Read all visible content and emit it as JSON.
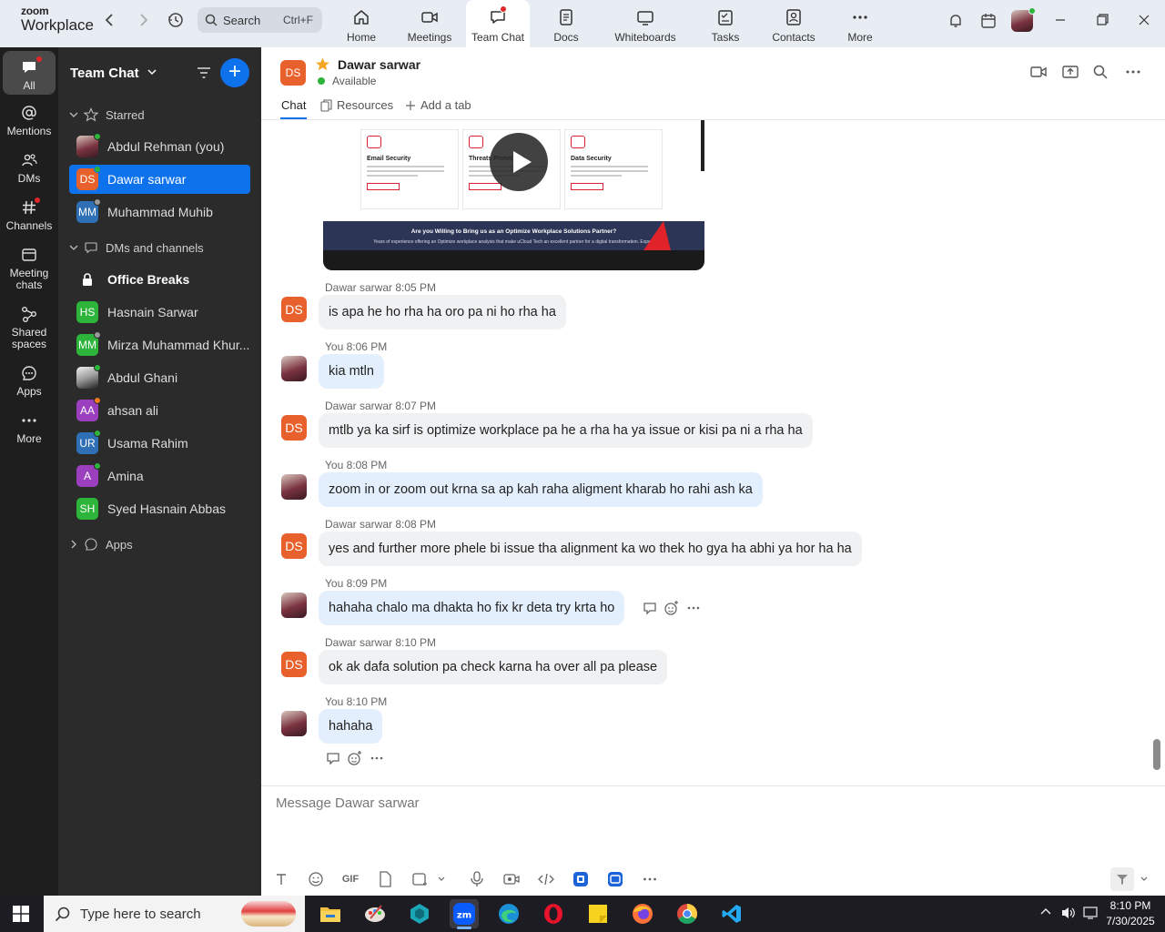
{
  "app": {
    "brand_top": "zoom",
    "brand_bottom": "Workplace"
  },
  "search": {
    "label": "Search",
    "shortcut": "Ctrl+F"
  },
  "top_tabs": [
    {
      "label": "Home"
    },
    {
      "label": "Meetings"
    },
    {
      "label": "Team Chat"
    },
    {
      "label": "Docs"
    },
    {
      "label": "Whiteboards"
    },
    {
      "label": "Tasks"
    },
    {
      "label": "Contacts"
    },
    {
      "label": "More"
    }
  ],
  "rail": [
    {
      "label": "All"
    },
    {
      "label": "Mentions"
    },
    {
      "label": "DMs"
    },
    {
      "label": "Channels"
    },
    {
      "label": "Meeting chats"
    },
    {
      "label": "Shared spaces"
    },
    {
      "label": "Apps"
    },
    {
      "label": "More"
    }
  ],
  "sidebar": {
    "title": "Team Chat",
    "starred_label": "Starred",
    "dms_label": "DMs and channels",
    "apps_label": "Apps",
    "starred": [
      {
        "name": "Abdul Rehman (you)",
        "initials": "",
        "color": ""
      },
      {
        "name": "Dawar sarwar",
        "initials": "DS",
        "color": "#e8612c"
      },
      {
        "name": "Muhammad Muhib",
        "initials": "MM",
        "color": "#2f6fb5"
      }
    ],
    "dms": [
      {
        "name": "Office Breaks",
        "initials": "",
        "color": ""
      },
      {
        "name": "Hasnain Sarwar",
        "initials": "HS",
        "color": "#2db43a"
      },
      {
        "name": "Mirza Muhammad Khur...",
        "initials": "MM",
        "color": "#2db43a"
      },
      {
        "name": "Abdul Ghani",
        "initials": "",
        "color": ""
      },
      {
        "name": "ahsan ali",
        "initials": "AA",
        "color": "#9b3fbf"
      },
      {
        "name": "Usama Rahim",
        "initials": "UR",
        "color": "#2f6fb5"
      },
      {
        "name": "Amina",
        "initials": "A",
        "color": "#9b3fbf"
      },
      {
        "name": "Syed Hasnain Abbas",
        "initials": "SH",
        "color": "#2db43a"
      }
    ]
  },
  "chat": {
    "contact_initials": "DS",
    "contact_name": "Dawar sarwar",
    "status": "Available",
    "tabs": [
      {
        "label": "Chat"
      },
      {
        "label": "Resources"
      },
      {
        "label": "Add a tab"
      }
    ],
    "preview": {
      "cards": [
        {
          "title": "Email Security"
        },
        {
          "title": "Threats Protection"
        },
        {
          "title": "Data Security"
        }
      ],
      "banner_title": "Are you Willing to Bring us as an Optimize Workplace Solutions Partner?",
      "banner_sub": "Years of experience offering an Optimize workplace analysis that make uCloud Tech an excellent partner for a digital transformation. Expect"
    },
    "messages": [
      {
        "sender": "Dawar sarwar",
        "time": "8:05 PM",
        "text": "is apa he ho rha ha oro pa ni ho rha ha",
        "mine": false
      },
      {
        "sender": "You",
        "time": "8:06 PM",
        "text": "kia mtln",
        "mine": true
      },
      {
        "sender": "Dawar sarwar",
        "time": "8:07 PM",
        "text": "mtlb ya ka sirf is optimize workplace pa he a rha ha ya issue or kisi pa ni a rha ha",
        "mine": false
      },
      {
        "sender": "You",
        "time": "8:08 PM",
        "text": "zoom in or zoom out krna sa ap kah raha aligment kharab ho rahi ash ka",
        "mine": true
      },
      {
        "sender": "Dawar sarwar",
        "time": "8:08 PM",
        "text": "yes and further more phele bi issue tha alignment ka wo thek ho gya ha abhi ya hor ha ha",
        "mine": false
      },
      {
        "sender": "You",
        "time": "8:09 PM",
        "text": "hahaha chalo ma dhakta ho fix kr deta try krta ho",
        "mine": true
      },
      {
        "sender": "Dawar sarwar",
        "time": "8:10 PM",
        "text": "ok ak dafa solution pa check karna ha over all pa please",
        "mine": false
      },
      {
        "sender": "You",
        "time": "8:10 PM",
        "text": "hahaha",
        "mine": true
      }
    ],
    "composer_placeholder": "Message Dawar sarwar",
    "gif_label": "GIF"
  },
  "taskbar": {
    "search_placeholder": "Type here to search",
    "time": "8:10 PM",
    "date": "7/30/2025"
  },
  "colors": {
    "accent": "#0e72ed",
    "ds_avatar": "#e8612c",
    "sidebar_bg": "#2b2b2b",
    "rail_bg": "#1e1e1e"
  }
}
